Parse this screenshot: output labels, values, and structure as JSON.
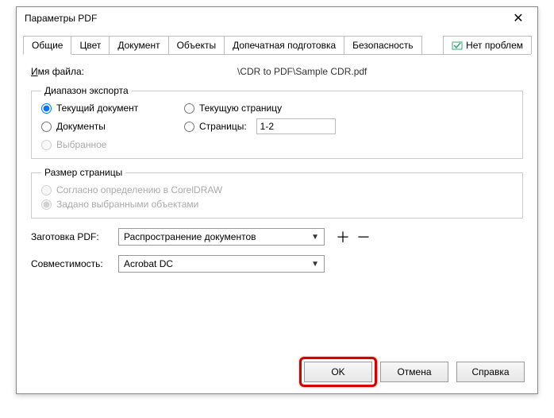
{
  "titlebar": {
    "title": "Параметры PDF"
  },
  "tabs": {
    "items": [
      {
        "label": "Общие"
      },
      {
        "label": "Цвет"
      },
      {
        "label": "Документ"
      },
      {
        "label": "Объекты"
      },
      {
        "label": "Допечатная подготовка"
      },
      {
        "label": "Безопасность"
      }
    ],
    "status": {
      "label": "Нет проблем"
    }
  },
  "filename": {
    "label": "Имя файла:",
    "value": "\\CDR to PDF\\Sample CDR.pdf"
  },
  "export_range": {
    "legend": "Диапазон экспорта",
    "current_document": "Текущий документ",
    "current_page": "Текущую страницу",
    "documents": "Документы",
    "pages": "Страницы:",
    "pages_value": "1-2",
    "selection": "Выбранное",
    "selected": "current_document"
  },
  "page_size": {
    "legend": "Размер страницы",
    "by_coreldraw": "Согласно определению в CorelDRAW",
    "by_objects": "Задано выбранными объектами"
  },
  "pdf_preset": {
    "label": "Заготовка PDF:",
    "value": "Распространение документов"
  },
  "compatibility": {
    "label": "Совместимость:",
    "value": "Acrobat DC"
  },
  "buttons": {
    "ok": "OK",
    "cancel": "Отмена",
    "help": "Справка"
  }
}
